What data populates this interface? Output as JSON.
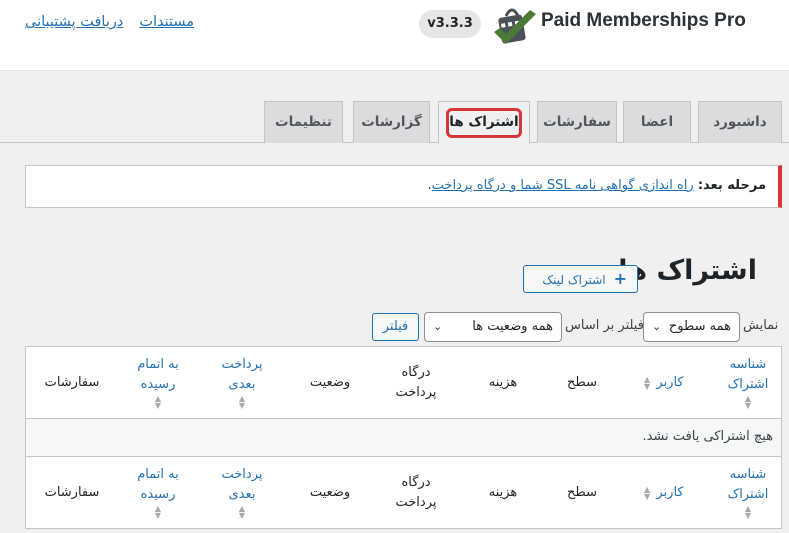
{
  "header": {
    "links": [
      "دریافت پشتیبانی",
      "مستندات"
    ],
    "version": "v3.3.3",
    "brand": "Paid Memberships Pro"
  },
  "tabs": [
    {
      "label": "داشبورد"
    },
    {
      "label": "اعضا"
    },
    {
      "label": "سفارشات"
    },
    {
      "label": "اشتراک ها",
      "active": true
    },
    {
      "label": "گزارشات"
    },
    {
      "label": "تنظیمات"
    }
  ],
  "notice": {
    "bold": "مرحله بعد:",
    "link": "راه اندازی گواهی نامه SSL شما و درگاه پرداخت",
    "end": "."
  },
  "page": {
    "title": "اشتراک ها",
    "add_button": "اشتراک لینک",
    "add_icon": "plus-icon"
  },
  "filters": {
    "show_label": "نمایش",
    "level_select": "همه سطوح",
    "filter_by_label": "فیلتر بر اساس",
    "status_select": "همه وضعیت ها",
    "filter_button": "فیلتر"
  },
  "table": {
    "columns": [
      {
        "l1": "شناسه",
        "l2": "اشتراک",
        "sortable": true
      },
      {
        "l1": "کاربر",
        "l2": "",
        "sortable": true
      },
      {
        "l1": "سطح",
        "l2": "",
        "sortable": false
      },
      {
        "l1": "هزینه",
        "l2": "",
        "sortable": false
      },
      {
        "l1": "درگاه",
        "l2": "پرداخت",
        "sortable": false
      },
      {
        "l1": "وضعیت",
        "l2": "",
        "sortable": false
      },
      {
        "l1": "پرداخت",
        "l2": "بعدی",
        "sortable": true
      },
      {
        "l1": "به اتمام",
        "l2": "رسیده",
        "sortable": true
      },
      {
        "l1": "سفارشات",
        "l2": "",
        "sortable": false
      }
    ],
    "empty_message": "هیچ اشتراکی یافت نشد."
  },
  "colors": {
    "link": "#2271b1",
    "alert": "#d63638",
    "logo_green": "#4a7b36",
    "logo_gray": "#4b5257"
  }
}
